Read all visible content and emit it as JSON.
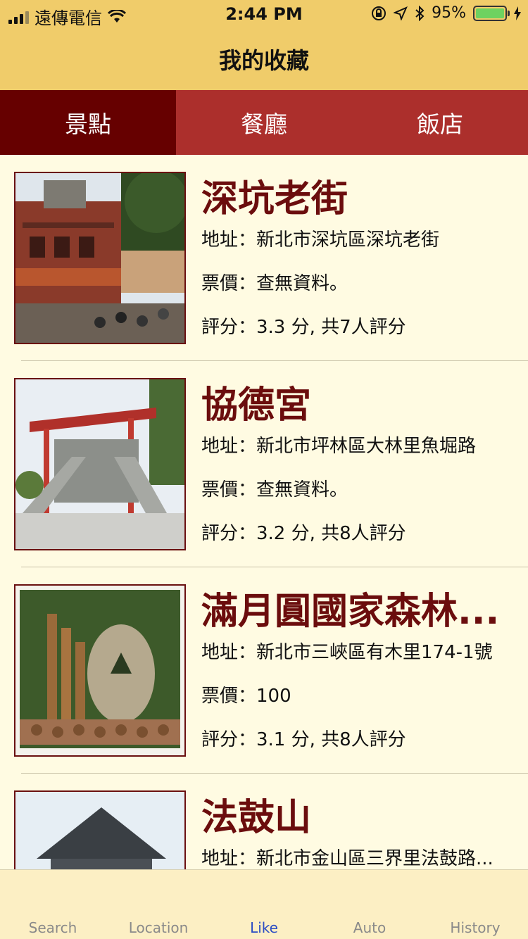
{
  "status": {
    "carrier": "遠傳電信",
    "time": "2:44 PM",
    "battery": "95%"
  },
  "nav": {
    "title": "我的收藏"
  },
  "segments": [
    {
      "label": "景點",
      "active": true
    },
    {
      "label": "餐廳",
      "active": false
    },
    {
      "label": "飯店",
      "active": false
    }
  ],
  "items": [
    {
      "name": "深坑老街",
      "address": "地址：新北市深坑區深坑老街",
      "ticket": "票價：查無資料。",
      "rating": "評分：3.3 分, 共7人評分"
    },
    {
      "name": "協德宮",
      "address": "地址：新北市坪林區大林里魚堀路",
      "ticket": "票價：查無資料。",
      "rating": "評分：3.2 分, 共8人評分"
    },
    {
      "name": "滿月圓國家森林...",
      "address": "地址：新北市三峽區有木里174-1號",
      "ticket": "票價：100",
      "rating": "評分：3.1 分, 共8人評分"
    },
    {
      "name": "法鼓山",
      "address": "地址：新北市金山區三界里法鼓路...",
      "ticket": "",
      "rating": ""
    }
  ],
  "tabbar": [
    {
      "label": "Search",
      "icon": "search-icon"
    },
    {
      "label": "Location",
      "icon": "location-icon"
    },
    {
      "label": "Like",
      "icon": "heart-icon",
      "active": true
    },
    {
      "label": "Auto",
      "icon": "auto-icon"
    },
    {
      "label": "History",
      "icon": "history-icon"
    }
  ]
}
